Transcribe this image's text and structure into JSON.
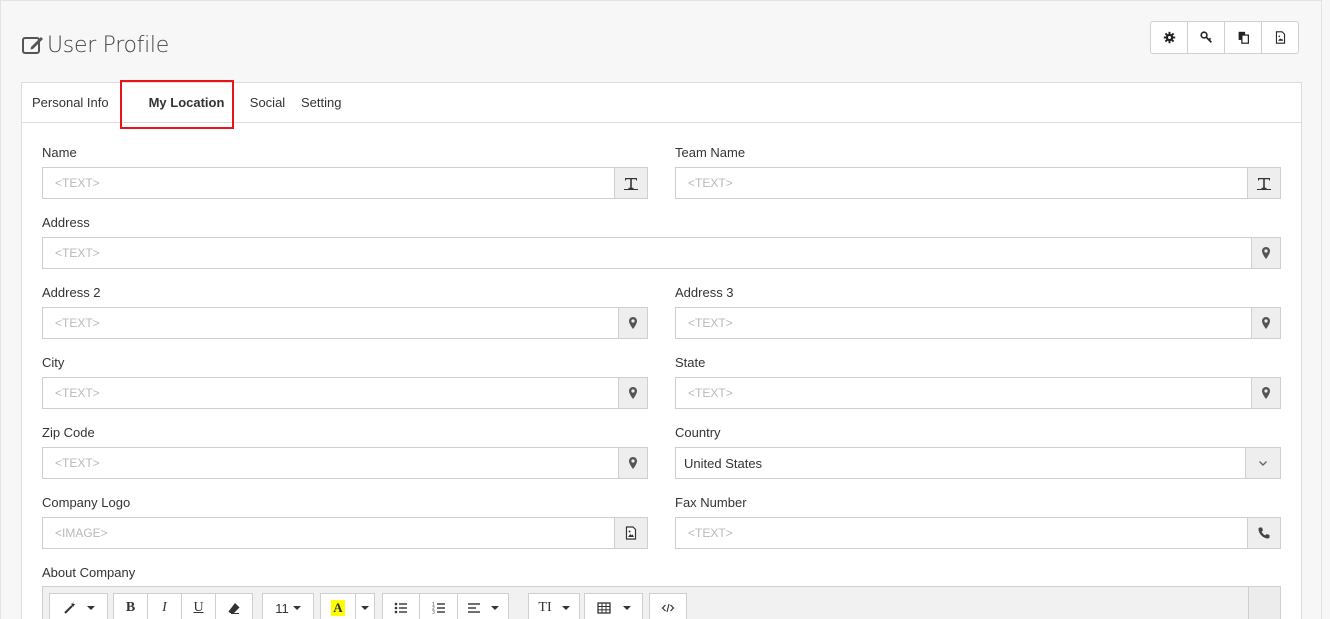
{
  "page": {
    "title": "User Profile"
  },
  "tabs": [
    {
      "label": "Personal Info"
    },
    {
      "label": "My Location"
    },
    {
      "label": "Social"
    },
    {
      "label": "Setting"
    }
  ],
  "fields": {
    "name": {
      "label": "Name",
      "placeholder": "<TEXT>"
    },
    "team_name": {
      "label": "Team Name",
      "placeholder": "<TEXT>"
    },
    "address": {
      "label": "Address",
      "placeholder": "<TEXT>"
    },
    "address2": {
      "label": "Address 2",
      "placeholder": "<TEXT>"
    },
    "address3": {
      "label": "Address 3",
      "placeholder": "<TEXT>"
    },
    "city": {
      "label": "City",
      "placeholder": "<TEXT>"
    },
    "state": {
      "label": "State",
      "placeholder": "<TEXT>"
    },
    "zip": {
      "label": "Zip Code",
      "placeholder": "<TEXT>"
    },
    "country": {
      "label": "Country",
      "value": "United States"
    },
    "company_logo": {
      "label": "Company Logo",
      "placeholder": "<IMAGE>"
    },
    "fax": {
      "label": "Fax Number",
      "placeholder": "<TEXT>"
    },
    "about": {
      "label": "About Company"
    }
  },
  "editor": {
    "font_size": "11",
    "bold": "B",
    "italic": "I",
    "underline": "U",
    "text_style": "TI"
  },
  "colors": {
    "highlight_border": "#e8141a",
    "font_color_swatch": "#ffff00"
  }
}
